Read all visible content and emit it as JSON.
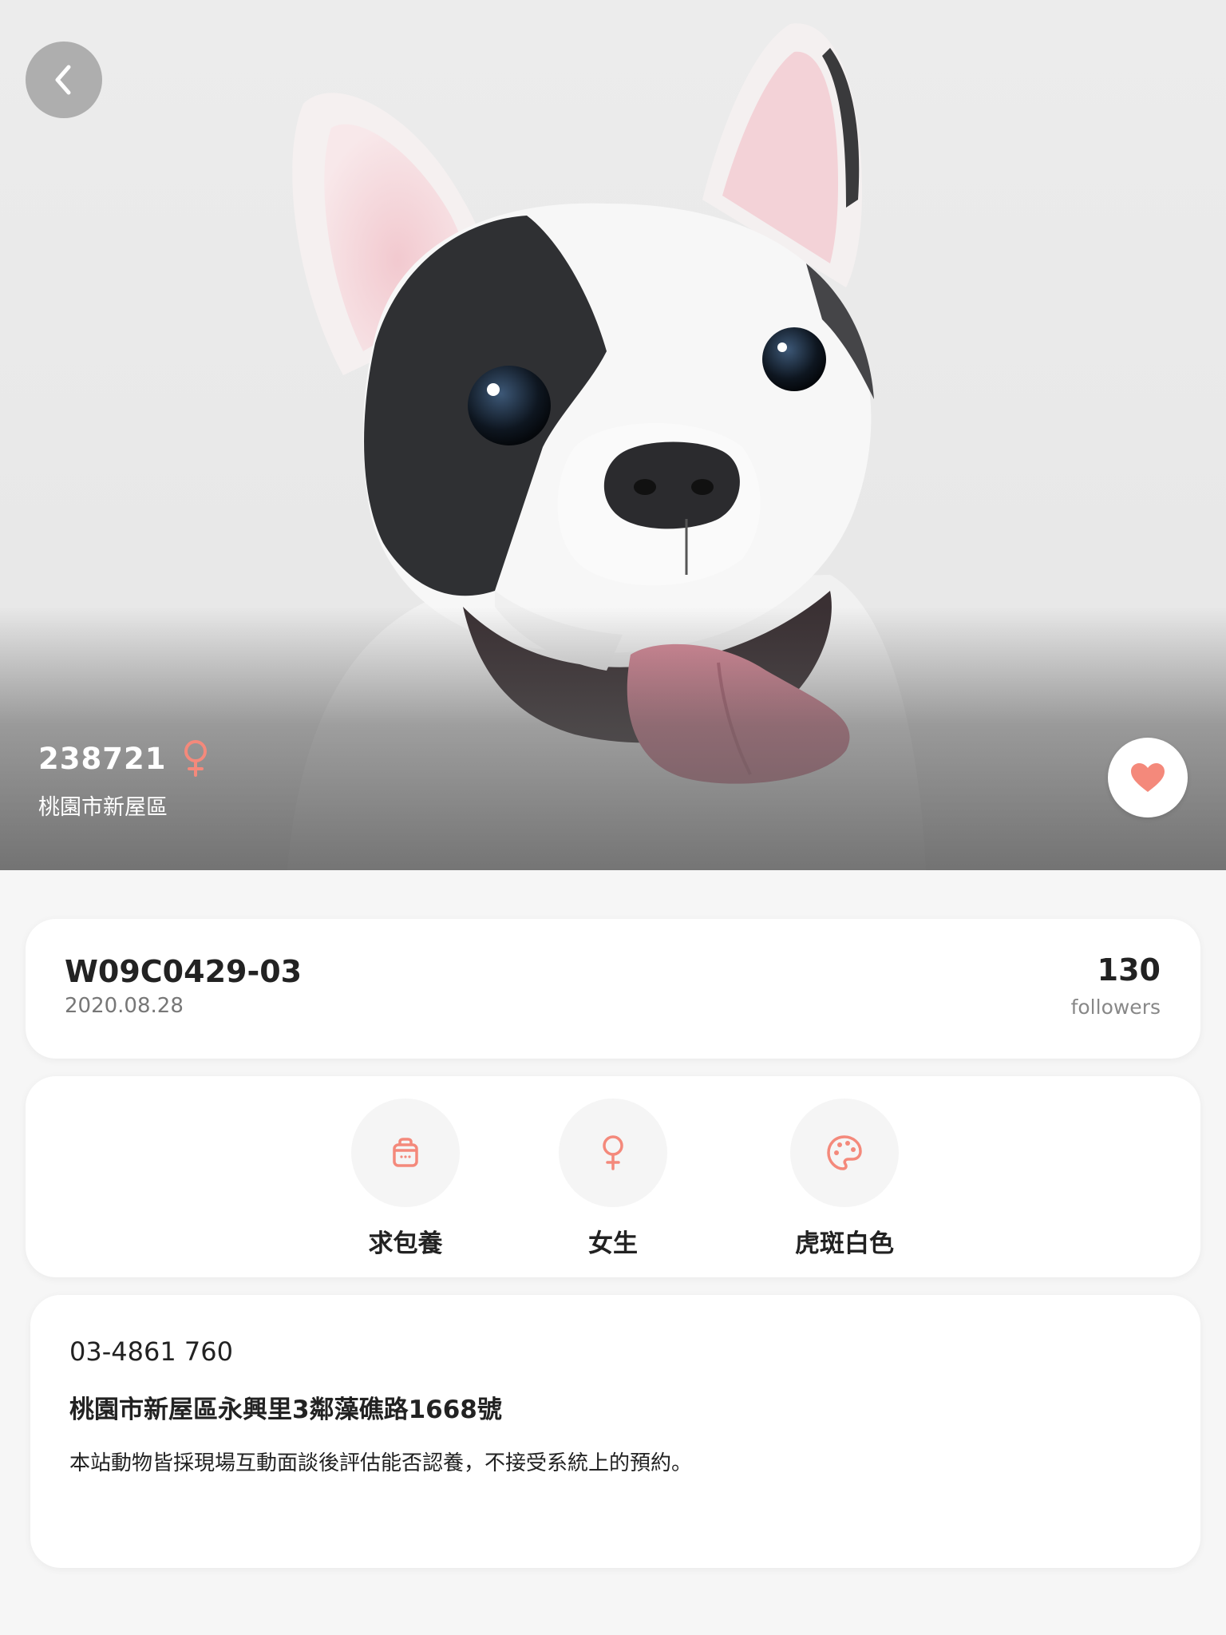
{
  "hero": {
    "pet_id": "238721",
    "area": "桃園市新屋區",
    "gender_icon": "female-icon",
    "back_icon": "chevron-left-icon",
    "favorite_icon": "heart-icon"
  },
  "summary": {
    "code": "W09C0429-03",
    "date": "2020.08.28",
    "followers_count": "130",
    "followers_label": "followers"
  },
  "attributes": [
    {
      "icon": "bag-icon",
      "label": "求包養"
    },
    {
      "icon": "female-icon",
      "label": "女生"
    },
    {
      "icon": "palette-icon",
      "label": "虎斑白色"
    }
  ],
  "contact": {
    "phone": "03-4861  760",
    "address": "桃園市新屋區永興里3鄰藻礁路1668號",
    "notice": "本站動物皆採現場互動面談後評估能否認養，不接受系統上的預約。"
  },
  "colors": {
    "accent": "#f4897b",
    "background": "#f6f6f6",
    "card": "#ffffff"
  }
}
